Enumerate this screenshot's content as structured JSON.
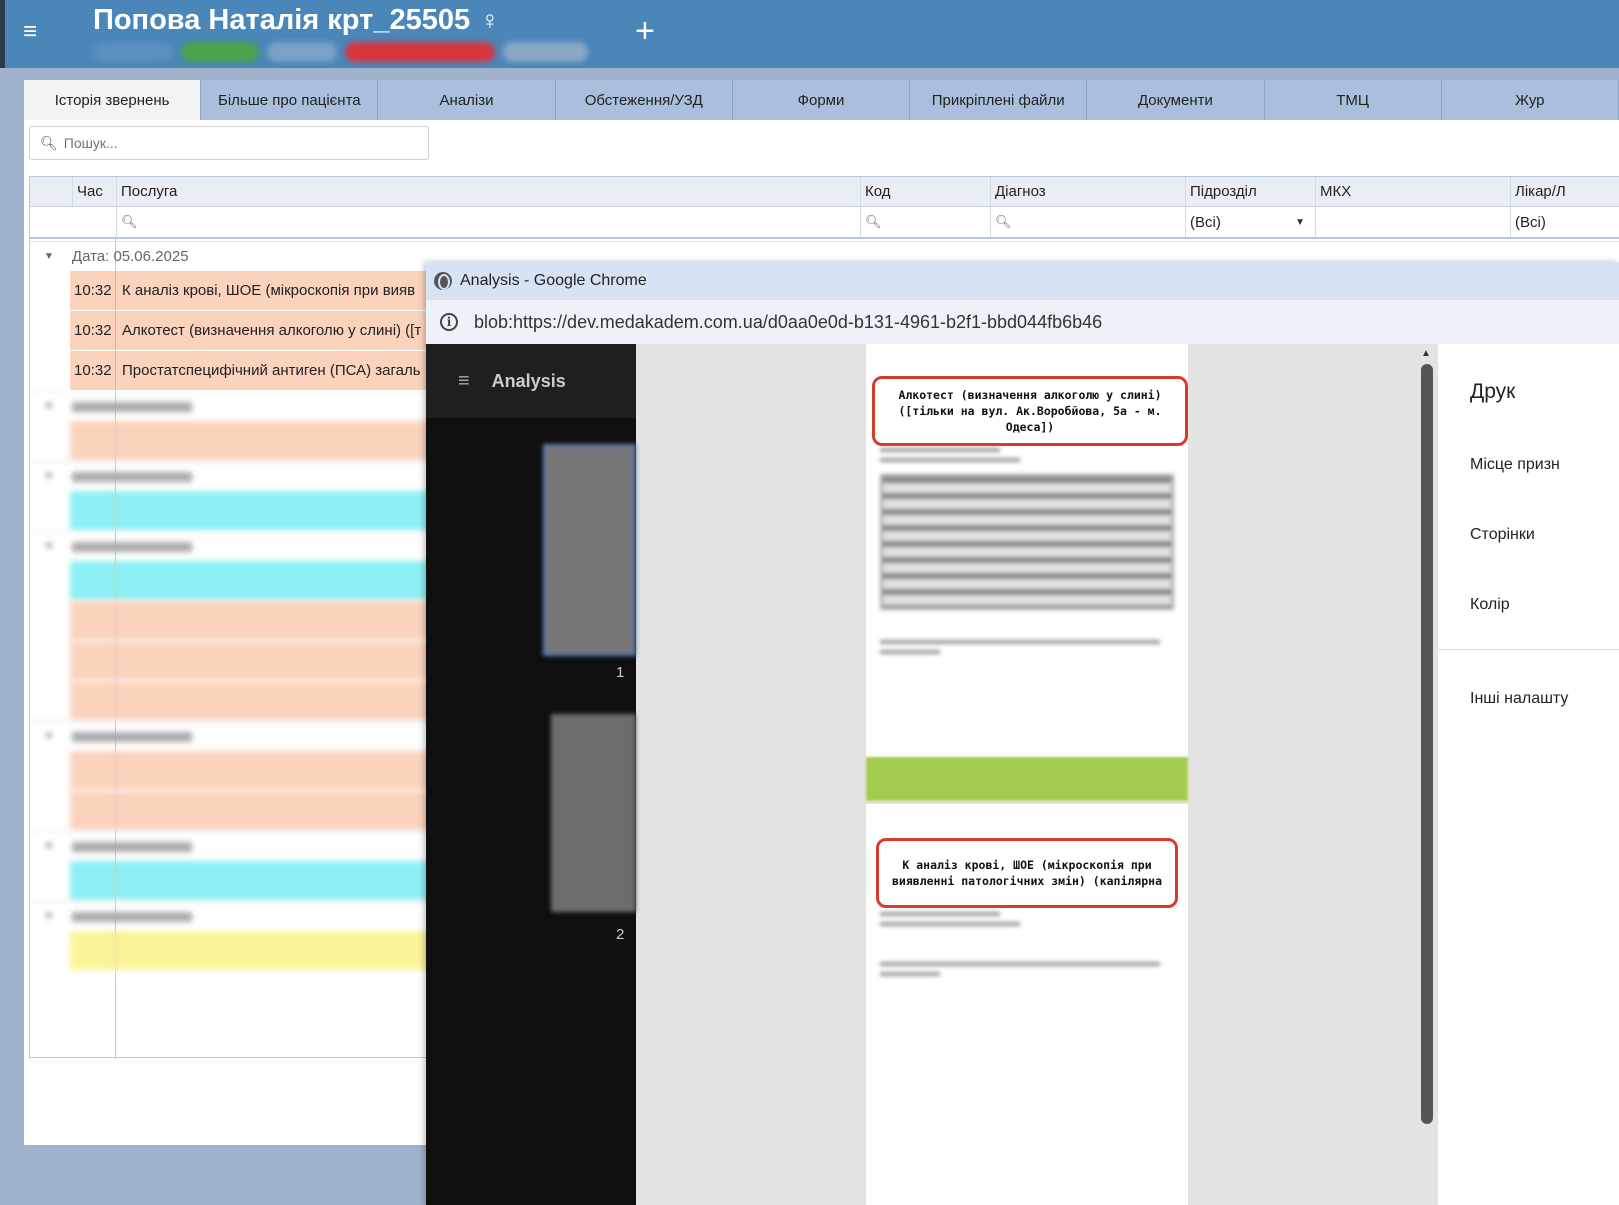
{
  "header": {
    "patient_name": "Попова Наталія крт_25505",
    "sex_symbol": "♀",
    "add_label": "+",
    "menu_icon": "hamburger-icon"
  },
  "tabs": [
    {
      "label": "Історія звернень",
      "active": true
    },
    {
      "label": "Більше про пацієнта"
    },
    {
      "label": "Аналізи"
    },
    {
      "label": "Обстеження/УЗД"
    },
    {
      "label": "Форми"
    },
    {
      "label": "Прикріплені файли"
    },
    {
      "label": "Документи"
    },
    {
      "label": "ТМЦ"
    },
    {
      "label": "Жур"
    }
  ],
  "search": {
    "placeholder": "Пошук..."
  },
  "grid": {
    "columns": {
      "time": "Час",
      "service": "Послуга",
      "code": "Код",
      "diagnosis": "Діагноз",
      "department": "Підрозділ",
      "mkh": "МКХ",
      "doctor": "Лікар/Л"
    },
    "filters": {
      "department": "(Всі)",
      "doctor": "(Всі)"
    },
    "group1": {
      "label": "Дата: 05.06.2025",
      "rows": [
        {
          "time": "10:32",
          "service": "К аналіз крові, ШОЕ (мікроскопія при вияв"
        },
        {
          "time": "10:32",
          "service": "Алкотест (визначення алкоголю у слині) ([т"
        },
        {
          "time": "10:32",
          "service": "Простатспецифічний антиген (ПСА) загаль"
        }
      ]
    }
  },
  "chrome": {
    "title": "Analysis - Google Chrome",
    "url": "blob:https://dev.medakadem.com.ua/d0aa0e0d-b131-4961-b2f1-bbd044fb6b46",
    "viewer_app": "Analysis",
    "thumb_pages": [
      "1",
      "2"
    ],
    "page1_heading": "Алкотест (визначення алкоголю у слині) ([тільки на вул. Ак.Воробйова, 5а - м. Одеса])",
    "page2_heading": "К аналіз крові, ШОЕ (мікроскопія при виявленні патологічних змін) (капілярна"
  },
  "print_panel": {
    "title": "Друк",
    "destination": "Місце призн",
    "pages": "Сторінки",
    "color": "Колір",
    "more": "Інші налашту"
  }
}
